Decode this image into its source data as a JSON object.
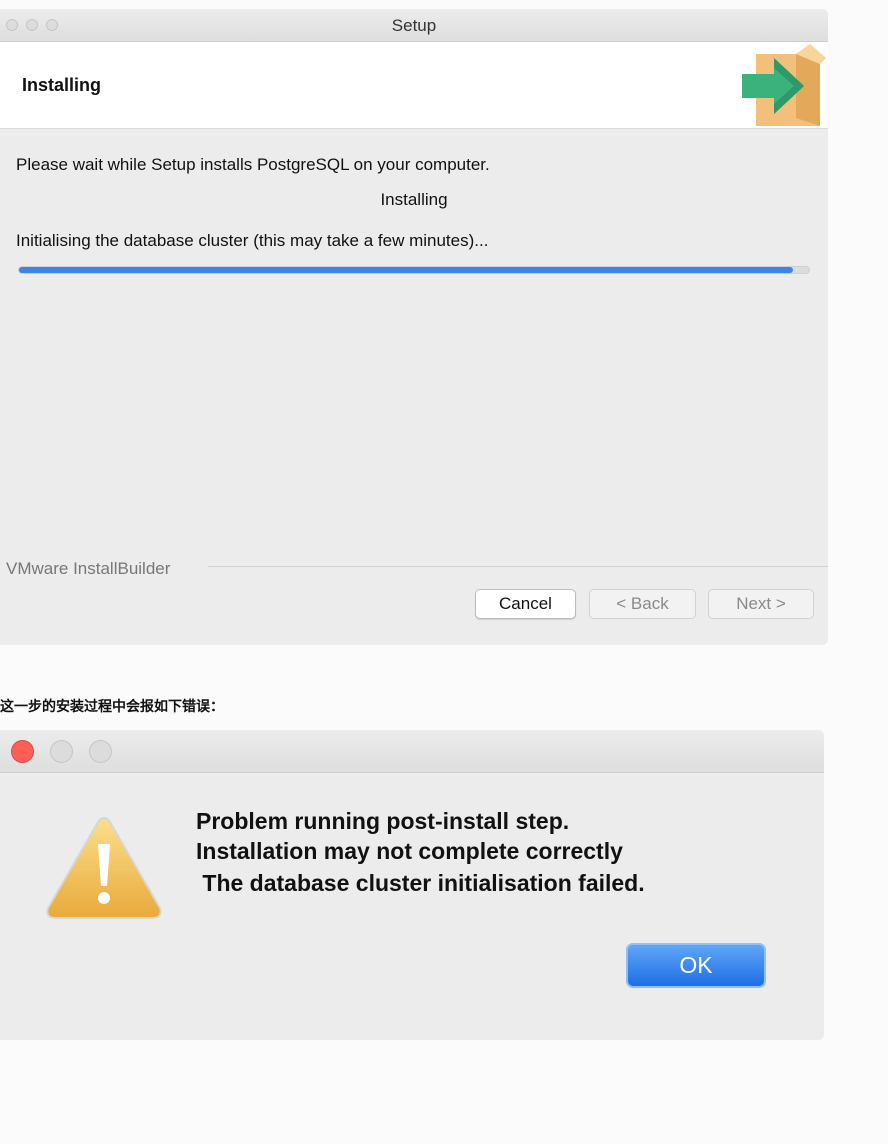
{
  "setup_window": {
    "title": "Setup",
    "header_title": "Installing",
    "intro_text": "Please wait while Setup installs PostgreSQL on your computer.",
    "status_heading": "Installing",
    "status_detail": "Initialising the database cluster (this may take a few minutes)...",
    "progress_fraction": 0.98,
    "brand_text": "VMware InstallBuilder",
    "buttons": {
      "cancel": "Cancel",
      "back": "< Back",
      "next": "Next >"
    },
    "icon": "box-arrow-icon"
  },
  "caption": "这一步的安装过程中会报如下错误：",
  "alert_window": {
    "message_lines": [
      "Problem running post-install step.",
      "Installation may not complete correctly",
      " The database cluster initialisation failed."
    ],
    "ok_label": "OK",
    "icon": "warning-icon"
  },
  "colors": {
    "progress": "#3a85e6",
    "ok_button": "#1e6fe4",
    "close_light": "#fc5f57",
    "icon_box": "#f2c07a",
    "icon_arrow": "#3bb17b"
  }
}
